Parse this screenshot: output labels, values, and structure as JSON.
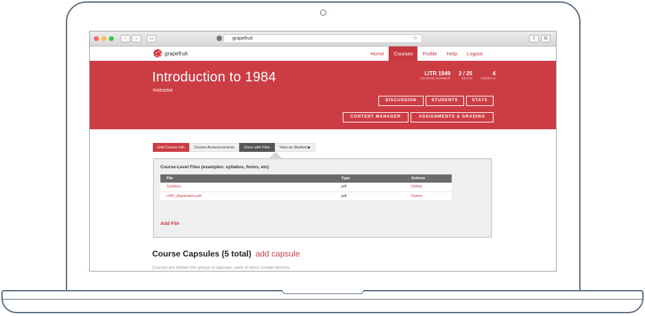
{
  "browser": {
    "url": "grapefruit",
    "reload_icon": "reload-icon"
  },
  "site": {
    "logo_text": "grapefruit",
    "nav": [
      "Home",
      "Courses",
      "Profile",
      "Help",
      "Logout"
    ],
    "active_nav": "Courses"
  },
  "course": {
    "title": "Introduction to 1984",
    "role": "Instructor",
    "stats": [
      {
        "value": "LITR 1949",
        "label": "COURSE NUMBER"
      },
      {
        "value": "2 / 25",
        "label": "SEATS"
      },
      {
        "value": "4",
        "label": "CREDITS"
      }
    ],
    "buttons_row1": [
      "DISCUSSION",
      "STUDENTS",
      "STATS"
    ],
    "buttons_row2": [
      "CONTENT MANAGER",
      "ASSIGNMENTS & GRADING"
    ]
  },
  "tabs": [
    "Edit Course Info",
    "Course Announcements",
    "Done with Files",
    "View as Student ▶"
  ],
  "files": {
    "title": "Course-Level Files (examples: syllabus, forms, etc)",
    "headers": [
      "File",
      "Type",
      "Actions"
    ],
    "rows": [
      {
        "file": "Syllabus",
        "type": "pdf",
        "action": "Delete"
      },
      {
        "file": "URP_Application.pdf",
        "type": "pdf",
        "action": "Delete"
      }
    ],
    "add_label": "Add File"
  },
  "capsules": {
    "heading": "Course Capsules (5 total)",
    "add_label": "add capsule",
    "note": "Courses are divided into groups of capsules, each of which contain lectures."
  },
  "colors": {
    "brand": "#cc3d43",
    "frame": "#5d6f85"
  }
}
